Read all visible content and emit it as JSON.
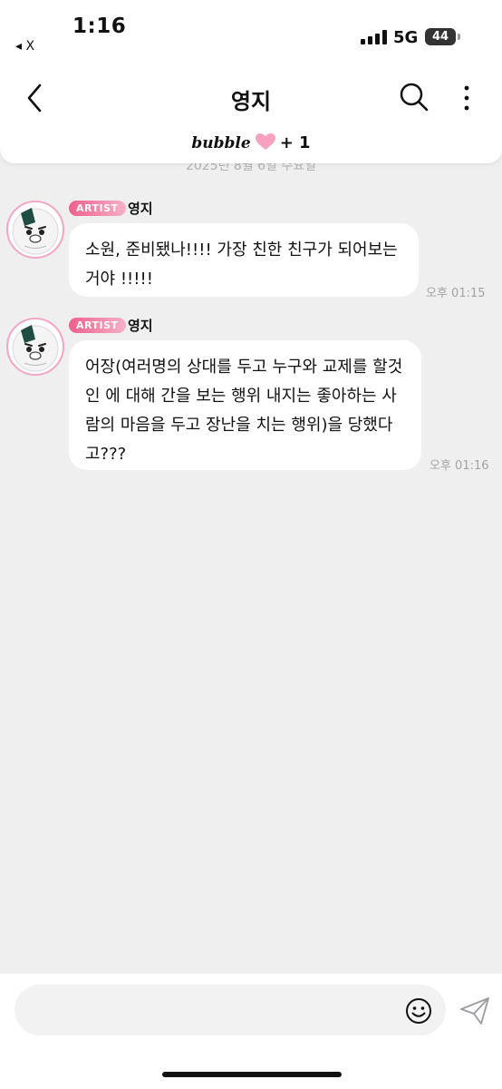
{
  "status_bar": {
    "time": "1:16",
    "back_app": "◂ X",
    "network": "5G",
    "battery": "44"
  },
  "header": {
    "title": "영지",
    "bubble_logo": "bubble",
    "bubble_count": "+ 1"
  },
  "date_divider": "2025년 8월 6일 수요일",
  "messages": [
    {
      "badge": "ARTIST",
      "sender": "영지",
      "text": "소원, 준비됐나!!!! 가장 친한 친구가 되어보는거야 !!!!!",
      "time": "오후 01:15"
    },
    {
      "badge": "ARTIST",
      "sender": "영지",
      "text": "어장(여러명의 상대를 두고 누구와 교제를 할것인 에 대해 간을 보는 행위 내지는 좋아하는 사람의 마음을 두고 장난을 치는 행위)을 당했다고???",
      "time": "오후 01:16"
    }
  ],
  "input": {
    "placeholder": "",
    "value": ""
  },
  "icons": {
    "back": "chevron-left-icon",
    "search": "search-icon",
    "more": "more-vertical-icon",
    "heart": "heart-icon",
    "emoji": "emoji-icon",
    "send": "send-icon"
  },
  "colors": {
    "background": "#efeff0",
    "artist_badge": "#ef5f8c",
    "avatar_ring": "#f3a6c3",
    "heart": "#f7a1bf"
  }
}
